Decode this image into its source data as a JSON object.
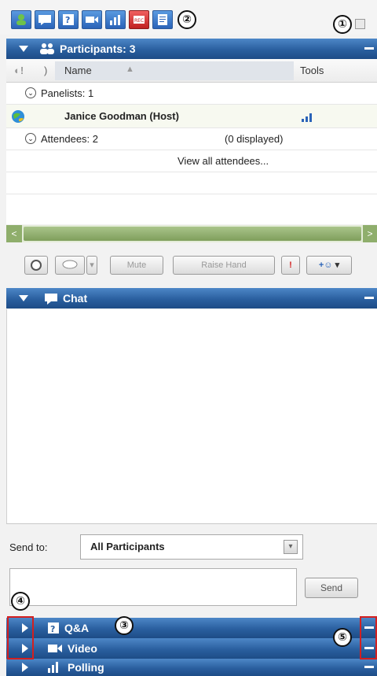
{
  "toolbar": {
    "icons": [
      "participants-icon",
      "chat-icon",
      "qa-icon",
      "video-icon",
      "polling-icon",
      "recorder-icon",
      "notes-icon"
    ],
    "callouts": [
      "①",
      "②"
    ]
  },
  "participants": {
    "title": "Participants: 3",
    "columns": {
      "name": "Name",
      "tools": "Tools"
    },
    "panelists_label": "Panelists: 1",
    "host_name": "Janice Goodman (Host)",
    "attendees_label": "Attendees: 2",
    "attendees_displayed": "(0 displayed)",
    "view_all": "View all attendees..."
  },
  "controls": {
    "mute": "Mute",
    "raise_hand": "Raise Hand",
    "alert": "!",
    "add_label": "+"
  },
  "chat": {
    "title": "Chat",
    "send_to_label": "Send to:",
    "send_to_value": "All Participants",
    "send_button": "Send"
  },
  "collapsed_panels": [
    {
      "title": "Q&A"
    },
    {
      "title": "Video"
    },
    {
      "title": "Polling"
    }
  ],
  "callouts": {
    "c1": "①",
    "c2": "②",
    "c3": "③",
    "c4": "④",
    "c5": "⑤"
  },
  "colors": {
    "bar": "#2a5f9f",
    "scrollbar": "#8fae6c",
    "highlight": "#d32020"
  }
}
